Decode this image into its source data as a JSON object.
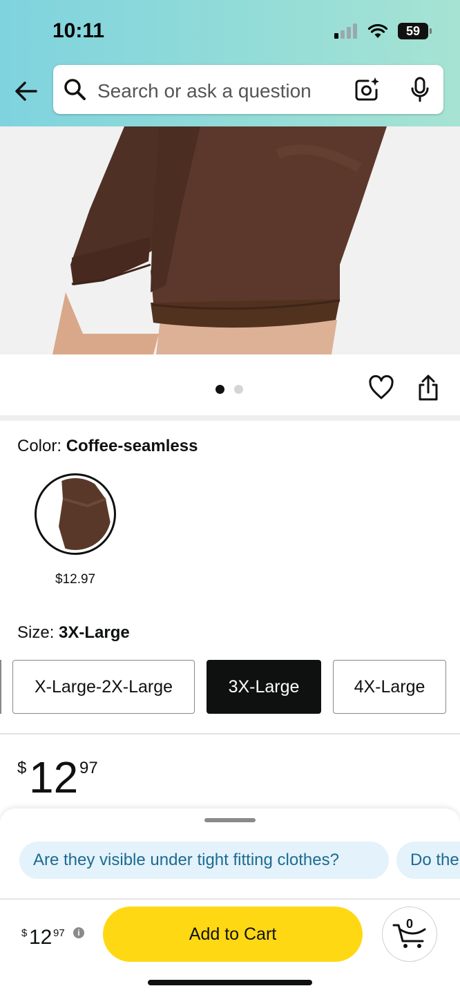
{
  "status_bar": {
    "time": "10:11",
    "battery": "59"
  },
  "search": {
    "placeholder": "Search or ask a question"
  },
  "gallery": {
    "page_count": 2,
    "active_index": 0
  },
  "color": {
    "label": "Color: ",
    "value": "Coffee-seamless",
    "swatch_price": "$12.97"
  },
  "size": {
    "label": "Size: ",
    "value": "3X-Large",
    "options": [
      "X-Large-2X-Large",
      "3X-Large",
      "4X-Large"
    ],
    "selected_index": 1
  },
  "price": {
    "currency": "$",
    "whole": "12",
    "fraction": "97"
  },
  "questions": [
    "Are they visible under tight fitting clothes?",
    "Do the"
  ],
  "buybar": {
    "price": {
      "currency": "$",
      "whole": "12",
      "fraction": "97"
    },
    "add_to_cart": "Add to Cart",
    "cart_count": "0"
  },
  "colors": {
    "accent_yellow": "#ffd814",
    "chip_bg": "#e3f2fb",
    "chip_text": "#1d6a8f",
    "product_brown": "#573629"
  }
}
